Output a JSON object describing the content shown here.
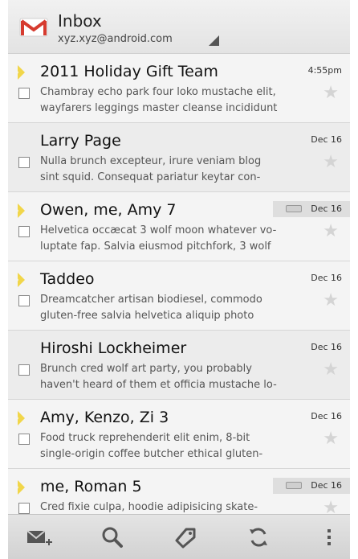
{
  "header": {
    "title": "Inbox",
    "account": "xyz.xyz@android.com",
    "logo_icon": "gmail-envelope-icon"
  },
  "colors": {
    "importance_marker": "#f1d64a",
    "star_inactive": "#d4d4d4",
    "gmail_red": "#d63b2f"
  },
  "messages": [
    {
      "sender": "2011 Holiday Gift Team",
      "date": "4:55pm",
      "snippet": "Chambray echo park four loko mustache elit,\nwayfarers leggings master cleanse incididunt",
      "important": true,
      "read": false,
      "has_label": false
    },
    {
      "sender": "Larry Page",
      "date": "Dec 16",
      "snippet": "Nulla brunch excepteur, irure veniam blog\nsint squid. Consequat pariatur keytar con-",
      "important": false,
      "read": true,
      "has_label": false
    },
    {
      "sender": "Owen, me, Amy  7",
      "date": "Dec 16",
      "snippet": "Helvetica occæcat 3 wolf moon whatever vo-\nluptate fap. Salvia eiusmod pitchfork, 3 wolf",
      "important": true,
      "read": false,
      "has_label": true
    },
    {
      "sender": "Taddeo",
      "date": "Dec 16",
      "snippet": "Dreamcatcher artisan biodiesel, commodo\ngluten-free salvia helvetica aliquip photo",
      "important": true,
      "read": false,
      "has_label": false
    },
    {
      "sender": "Hiroshi Lockheimer",
      "date": "Dec 16",
      "snippet": "Brunch cred wolf art party, you probably\nhaven't heard of them et officia mustache lo-",
      "important": false,
      "read": true,
      "has_label": false
    },
    {
      "sender": "Amy, Kenzo, Zi  3",
      "date": "Dec 16",
      "snippet": "Food truck reprehenderit elit enim, 8-bit\nsingle-origin coffee butcher ethical gluten-",
      "important": true,
      "read": false,
      "has_label": false
    },
    {
      "sender": "me, Roman  5",
      "date": "Dec 16",
      "snippet": "Cred fixie culpa, hoodie adipisicing skate-",
      "important": true,
      "read": false,
      "has_label": true
    }
  ],
  "bottom_bar": [
    {
      "icon": "compose-icon",
      "label": "Compose"
    },
    {
      "icon": "search-icon",
      "label": "Search"
    },
    {
      "icon": "label-icon",
      "label": "Labels"
    },
    {
      "icon": "refresh-icon",
      "label": "Refresh"
    },
    {
      "icon": "overflow-menu-icon",
      "label": "More"
    }
  ]
}
